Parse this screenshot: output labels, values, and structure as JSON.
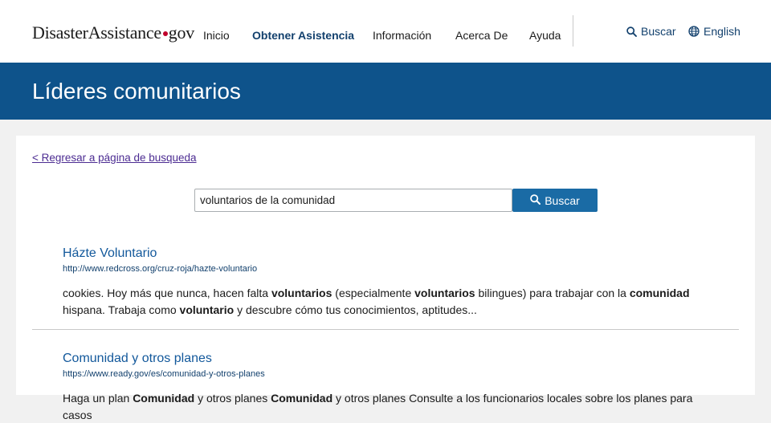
{
  "header": {
    "logo_part1": "Disaster",
    "logo_part2": "Assistance",
    "logo_part3": "gov",
    "nav": [
      "Inicio",
      "Obtener Asistencia",
      "Información",
      "Acerca De",
      "Ayuda"
    ],
    "search_label": "Buscar",
    "language_label": "English"
  },
  "banner": {
    "title": "Líderes comunitarios"
  },
  "content": {
    "back_link": "< Regresar a página de busqueda",
    "search": {
      "value": "voluntarios de la comunidad",
      "button_label": "Buscar"
    },
    "results": [
      {
        "title": "Házte Voluntario",
        "url": "http://www.redcross.org/cruz-roja/hazte-voluntario",
        "snippet": [
          {
            "t": "cookies. Hoy más que nunca, hacen falta "
          },
          {
            "t": "voluntarios",
            "b": true
          },
          {
            "t": " (especialmente "
          },
          {
            "t": "voluntarios",
            "b": true
          },
          {
            "t": " bilingues) para trabajar con la "
          },
          {
            "t": "comunidad",
            "b": true
          },
          {
            "t": " hispana. Trabaja como "
          },
          {
            "t": "voluntario",
            "b": true
          },
          {
            "t": " y descubre cómo tus conocimientos, aptitudes..."
          }
        ]
      },
      {
        "title": "Comunidad y otros planes",
        "url": "https://www.ready.gov/es/comunidad-y-otros-planes",
        "snippet": [
          {
            "t": "Haga un plan "
          },
          {
            "t": "Comunidad",
            "b": true
          },
          {
            "t": " y otros planes "
          },
          {
            "t": "Comunidad",
            "b": true
          },
          {
            "t": " y otros planes Consulte a los funcionarios locales sobre los planes para casos"
          }
        ]
      }
    ]
  },
  "colors": {
    "brand_blue": "#0e538b",
    "link_blue": "#12589b",
    "button_blue": "#1a6ba5",
    "logo_dot_red": "#c0002b"
  },
  "icons": [
    "search-icon",
    "globe-icon"
  ]
}
